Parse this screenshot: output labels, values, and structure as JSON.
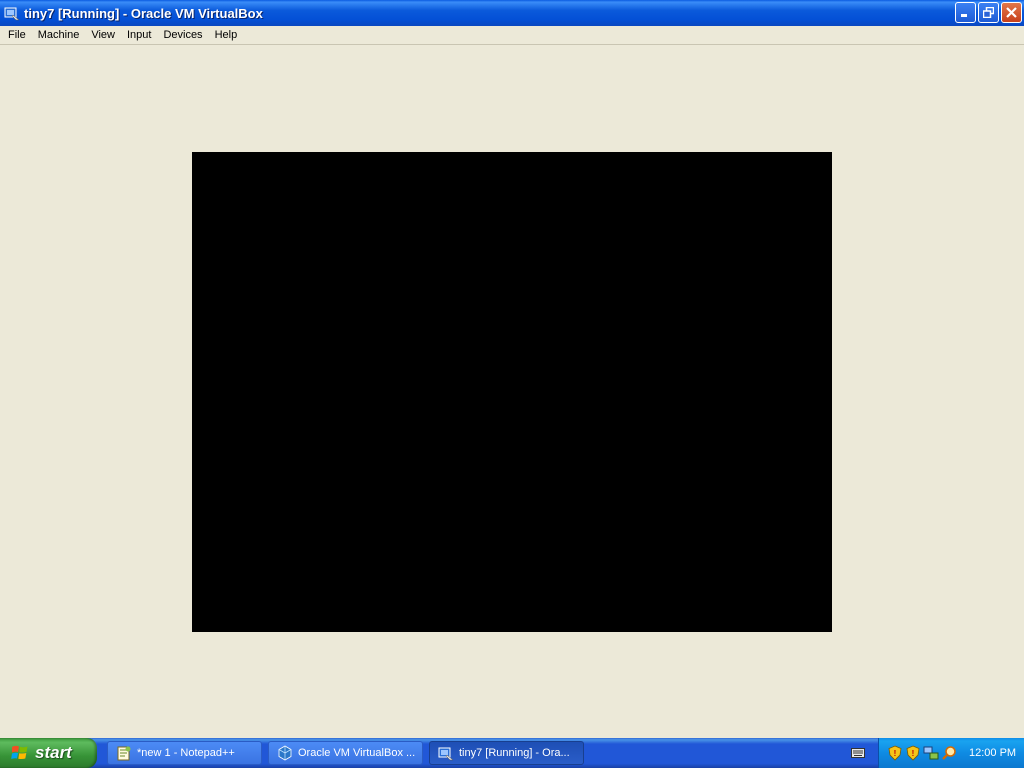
{
  "window": {
    "title": "tiny7 [Running] - Oracle VM VirtualBox",
    "buttons": [
      "minimize",
      "restore",
      "close"
    ]
  },
  "menubar": {
    "items": [
      {
        "label": "File"
      },
      {
        "label": "Machine"
      },
      {
        "label": "View"
      },
      {
        "label": "Input"
      },
      {
        "label": "Devices"
      },
      {
        "label": "Help"
      }
    ]
  },
  "vm_display": {
    "background": "#000000"
  },
  "taskbar": {
    "start_label": "start",
    "tasks": [
      {
        "label": "*new 1 - Notepad++",
        "icon": "notepad-plus-plus-icon"
      },
      {
        "label": "Oracle VM VirtualBox ...",
        "icon": "virtualbox-icon"
      },
      {
        "label": "tiny7 [Running] - Ora...",
        "icon": "virtualbox-vm-icon"
      }
    ],
    "tray_icons": [
      "security-shield-icon",
      "security-shield-icon",
      "network-icon",
      "search-icon"
    ],
    "clock": "12:00 PM"
  },
  "colors": {
    "titlebar": "#0450D6",
    "desktop_bg": "#ECE9D8",
    "start_green": "#379337",
    "tray_blue": "#0F8BE3"
  }
}
